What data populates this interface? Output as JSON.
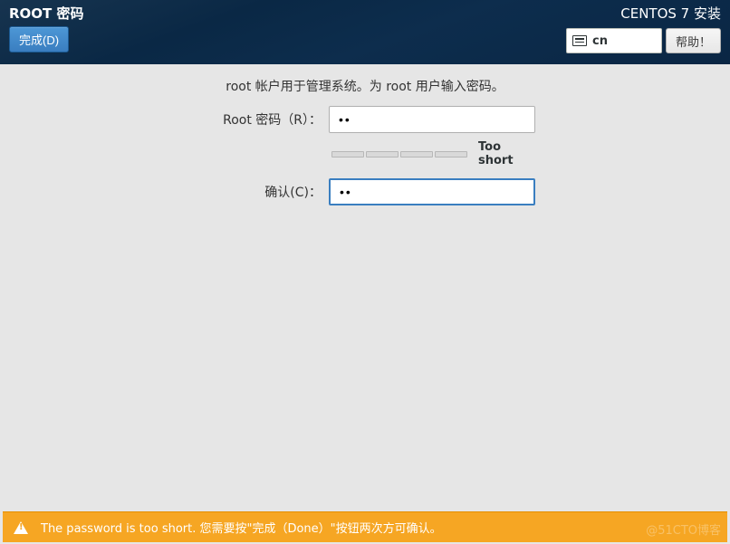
{
  "header": {
    "title": "ROOT 密码",
    "done_label": "完成(D)",
    "installer_title": "CENTOS 7 安装",
    "keyboard_layout": "cn",
    "help_label": "帮助！"
  },
  "main": {
    "instruction": "root 帐户用于管理系统。为 root 用户输入密码。",
    "root_password_label": "Root 密码（R）：",
    "root_password_value": "••",
    "confirm_label": "确认(C)：",
    "confirm_value": "••",
    "strength_label": "Too short"
  },
  "warning": {
    "message": "The password is too short. 您需要按\"完成（Done）\"按钮两次方可确认。"
  },
  "watermark": "@51CTO博客"
}
